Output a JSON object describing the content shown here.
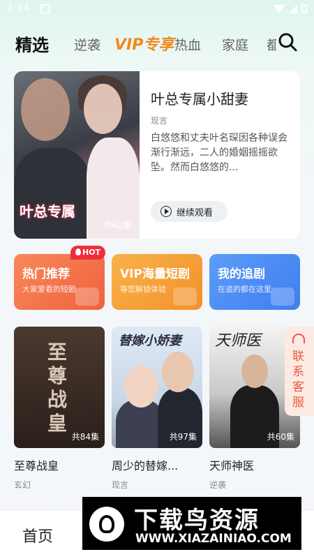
{
  "status_bar": {
    "time": "2:14"
  },
  "tabs": [
    {
      "label": "精选",
      "active": true
    },
    {
      "label": "逆袭"
    },
    {
      "label": "VIP专享",
      "vip": true
    },
    {
      "label": "热血"
    },
    {
      "label": "家庭"
    },
    {
      "label": "都"
    }
  ],
  "featured": {
    "poster_title": "叶总专属",
    "episode_count": "共62集",
    "title": "叶总专属小甜妻",
    "genre": "现言",
    "description": "白悠悠和丈夫叶名琛因各种误会渐行渐远，二人的婚姻摇摇欲坠。然而白悠悠的...",
    "continue_label": "继续观看"
  },
  "quick_entries": [
    {
      "title": "热门推荐",
      "subtitle": "大家爱看的短剧",
      "badge": "HOT",
      "color": "#f5764a"
    },
    {
      "title": "VIP海量短剧",
      "subtitle": "等您解锁体验",
      "color": "#f7a43c"
    },
    {
      "title": "我的追剧",
      "subtitle": "在追的都在这里",
      "color": "#4c8df5"
    }
  ],
  "dramas": [
    {
      "poster_text": "至尊战皇",
      "episodes": "共84集",
      "name": "至尊战皇",
      "genre": "玄幻"
    },
    {
      "poster_text": "替嫁小娇妻",
      "episodes": "共97集",
      "name": "周少的替嫁...",
      "genre": "现言"
    },
    {
      "poster_text": "天师医",
      "episodes": "共60集",
      "name": "天师神医",
      "genre": "逆袭"
    }
  ],
  "service": {
    "label": "联系客服"
  },
  "bottom_nav": {
    "home": "首页"
  },
  "watermark": {
    "title": "下载鸟资源",
    "url": "WWW.XIAZAINIAO.COM"
  }
}
